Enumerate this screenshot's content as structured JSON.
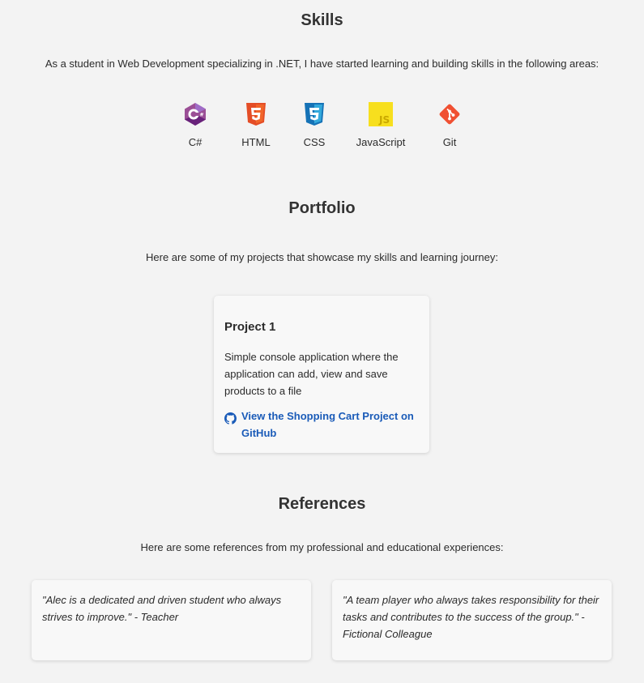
{
  "skills": {
    "title": "Skills",
    "intro": "As a student in Web Development specializing in .NET, I have started learning and building skills in the following areas:",
    "items": [
      {
        "label": "C#",
        "icon": "csharp-icon",
        "color": "#68217a"
      },
      {
        "label": "HTML",
        "icon": "html5-icon",
        "color": "#e44d26"
      },
      {
        "label": "CSS",
        "icon": "css3-icon",
        "color": "#1572b6"
      },
      {
        "label": "JavaScript",
        "icon": "javascript-icon",
        "color": "#f7df1e"
      },
      {
        "label": "Git",
        "icon": "git-icon",
        "color": "#f05032"
      }
    ]
  },
  "portfolio": {
    "title": "Portfolio",
    "intro": "Here are some of my projects that showcase my skills and learning journey:",
    "projects": [
      {
        "title": "Project 1",
        "description": "Simple console application where the application can add, view and save products to a file",
        "link_text": "View the Shopping Cart Project on GitHub",
        "link_icon": "github-icon",
        "link_color": "#1a5bb8"
      }
    ]
  },
  "references": {
    "title": "References",
    "intro": "Here are some references from my professional and educational experiences:",
    "items": [
      {
        "quote": "\"Alec is a dedicated and driven student who always strives to improve.\" - Teacher"
      },
      {
        "quote": "\"A team player who always takes responsibility for their tasks and contributes to the success of the group.\" - Fictional Colleague"
      }
    ]
  },
  "colors": {
    "background": "#f3f3f3",
    "card": "#f8f8f8",
    "text": "#2b2b2b",
    "link": "#1a5bb8"
  }
}
